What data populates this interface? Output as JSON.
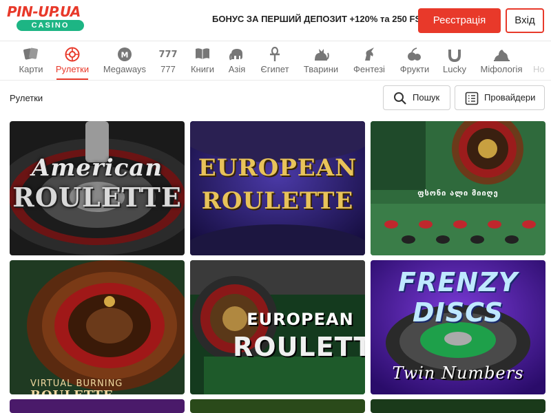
{
  "header": {
    "logo_text": "PIN-UP.UA",
    "logo_sub": "CASINO",
    "bonus": "БОНУС ЗА ПЕРШИЙ ДЕПОЗИТ +120% та 250 FS",
    "register_label": "Реєстрація",
    "login_label": "Вхід"
  },
  "categories": [
    {
      "label": "Карти",
      "icon": "cards-icon"
    },
    {
      "label": "Рулетки",
      "icon": "roulette-icon"
    },
    {
      "label": "Megaways",
      "icon": "megaways-icon"
    },
    {
      "label": "777",
      "icon": "sevens-icon"
    },
    {
      "label": "Книги",
      "icon": "book-icon"
    },
    {
      "label": "Азія",
      "icon": "elephant-icon"
    },
    {
      "label": "Єгипет",
      "icon": "ankh-icon"
    },
    {
      "label": "Тварини",
      "icon": "cat-icon"
    },
    {
      "label": "Фентезі",
      "icon": "unicorn-icon"
    },
    {
      "label": "Фрукти",
      "icon": "fruit-icon"
    },
    {
      "label": "Lucky",
      "icon": "horseshoe-icon"
    },
    {
      "label": "Міфологія",
      "icon": "mythology-icon"
    },
    {
      "label": "Но",
      "icon": "new-icon"
    }
  ],
  "active_category": "Рулетки",
  "section": {
    "title": "Рулетки",
    "search_label": "Пошук",
    "providers_label": "Провайдери"
  },
  "games": [
    {
      "line1": "American",
      "line2": "ROULETTE"
    },
    {
      "line1": "EUROPEAN",
      "line2": "ROULETTE"
    },
    {
      "line1": "ფსონი ალი მიიღე",
      "line2": ""
    },
    {
      "line1": "VIRTUAL BURNING",
      "line2": "ROULETTE"
    },
    {
      "line1": "EUROPEAN",
      "line2": "ROULETTE"
    },
    {
      "line1": "FRENZY DISCS",
      "line2": "Twin Numbers"
    }
  ],
  "colors": {
    "accent": "#e8392a",
    "brand_green": "#1db584"
  }
}
